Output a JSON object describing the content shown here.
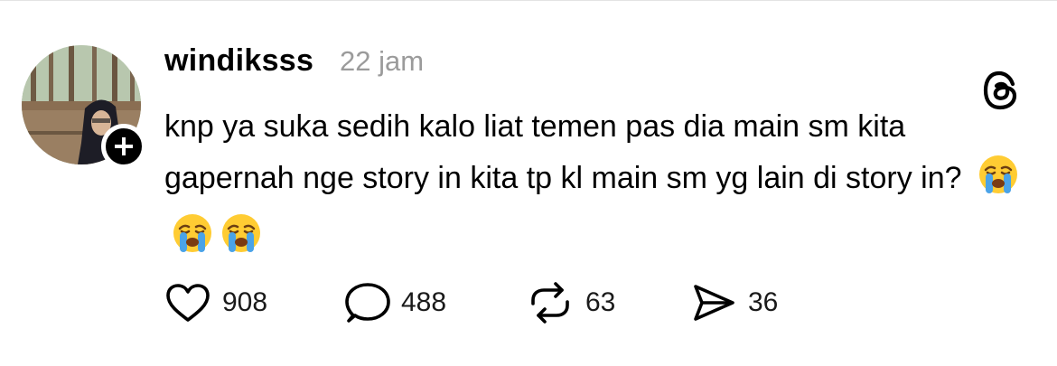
{
  "post": {
    "username": "windiksss",
    "timestamp": "22 jam",
    "text": "knp ya suka sedih kalo liat temen pas dia main sm kita gapernah nge story in kita tp kl main sm yg lain di story in?",
    "emojis": [
      "crying-face",
      "crying-face",
      "crying-face"
    ]
  },
  "actions": {
    "likes": "908",
    "replies": "488",
    "reposts": "63",
    "shares": "36"
  }
}
